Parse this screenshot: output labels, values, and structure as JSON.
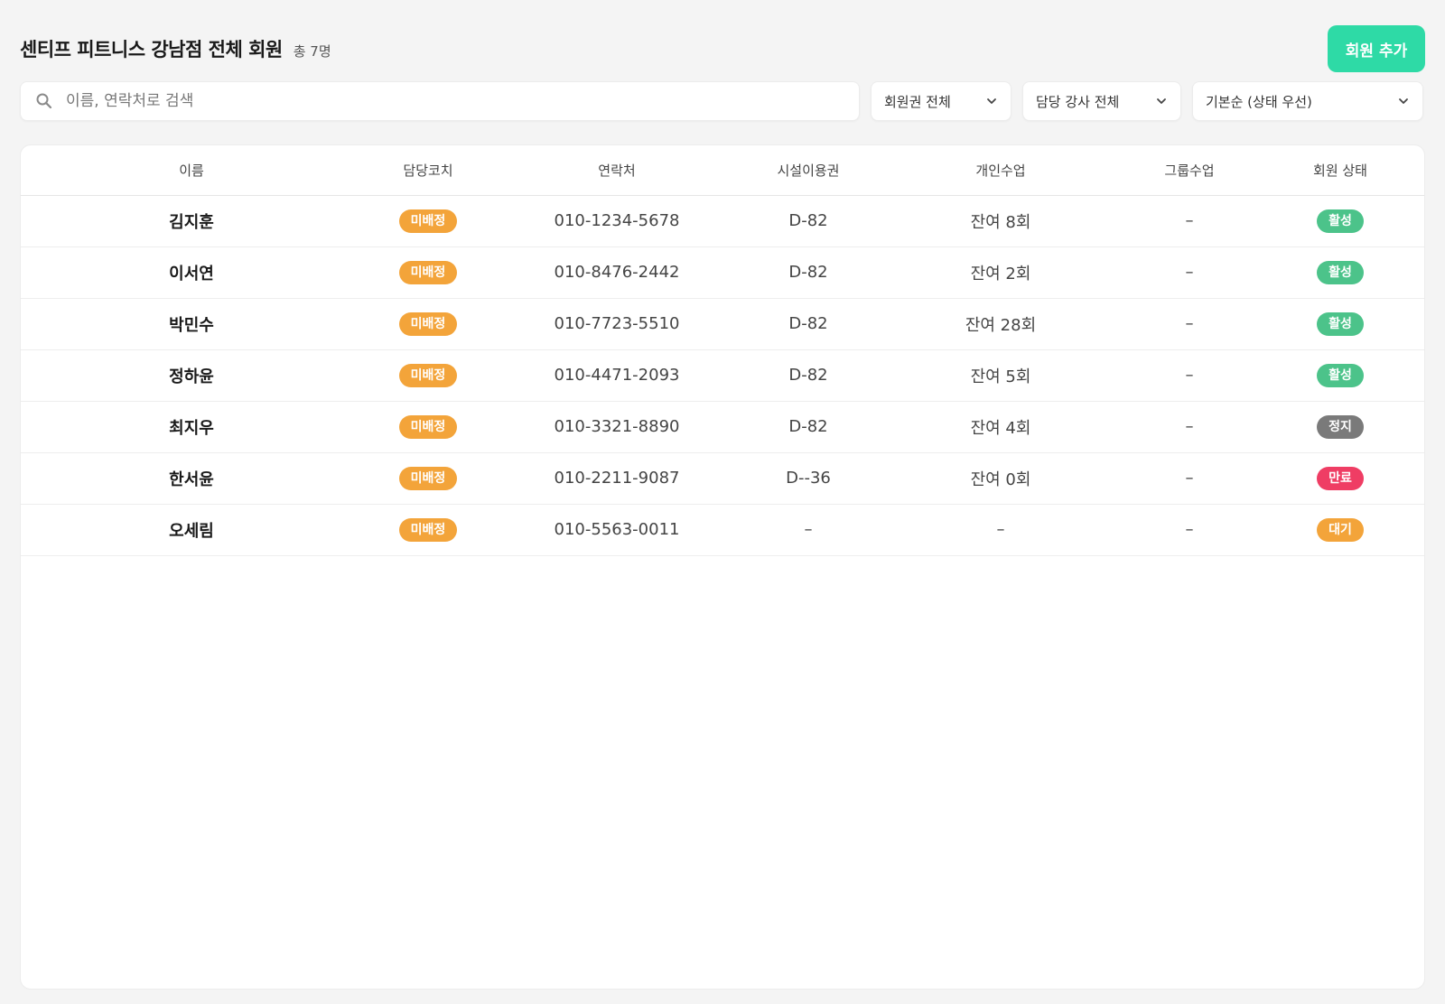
{
  "header": {
    "title": "센티프 피트니스 강남점 전체 회원",
    "total": "총 7명",
    "add_button": "회원 추가",
    "accent_color": "#2edaa6"
  },
  "search": {
    "placeholder": "이름, 연락처로 검색",
    "value": "",
    "icon": "search-icon"
  },
  "filters": {
    "membership": "회원권 전체",
    "coach": "담당 강사 전체",
    "sort": "기본순 (상태 우선)"
  },
  "table": {
    "columns": [
      "이름",
      "담당코치",
      "연락처",
      "시설이용권",
      "개인수업",
      "그룹수업",
      "회원 상태"
    ],
    "rows": [
      {
        "name": "김지훈",
        "coach": "미배정",
        "phone": "010-1234-5678",
        "facility": "D-82",
        "personal": "잔여 8회",
        "group": "–",
        "status": "활성",
        "status_color": "#4cc38a"
      },
      {
        "name": "이서연",
        "coach": "미배정",
        "phone": "010-8476-2442",
        "facility": "D-82",
        "personal": "잔여 2회",
        "group": "–",
        "status": "활성",
        "status_color": "#4cc38a"
      },
      {
        "name": "박민수",
        "coach": "미배정",
        "phone": "010-7723-5510",
        "facility": "D-82",
        "personal": "잔여 28회",
        "group": "–",
        "status": "활성",
        "status_color": "#4cc38a"
      },
      {
        "name": "정하윤",
        "coach": "미배정",
        "phone": "010-4471-2093",
        "facility": "D-82",
        "personal": "잔여 5회",
        "group": "–",
        "status": "활성",
        "status_color": "#4cc38a"
      },
      {
        "name": "최지우",
        "coach": "미배정",
        "phone": "010-3321-8890",
        "facility": "D-82",
        "personal": "잔여 4회",
        "group": "–",
        "status": "정지",
        "status_color": "#7a7a7a"
      },
      {
        "name": "한서윤",
        "coach": "미배정",
        "phone": "010-2211-9087",
        "facility": "D--36",
        "personal": "잔여 0회",
        "group": "–",
        "status": "만료",
        "status_color": "#ef3d64"
      },
      {
        "name": "오세림",
        "coach": "미배정",
        "phone": "010-5563-0011",
        "facility": "–",
        "personal": "–",
        "group": "–",
        "status": "대기",
        "status_color": "#f3a43a"
      }
    ]
  }
}
